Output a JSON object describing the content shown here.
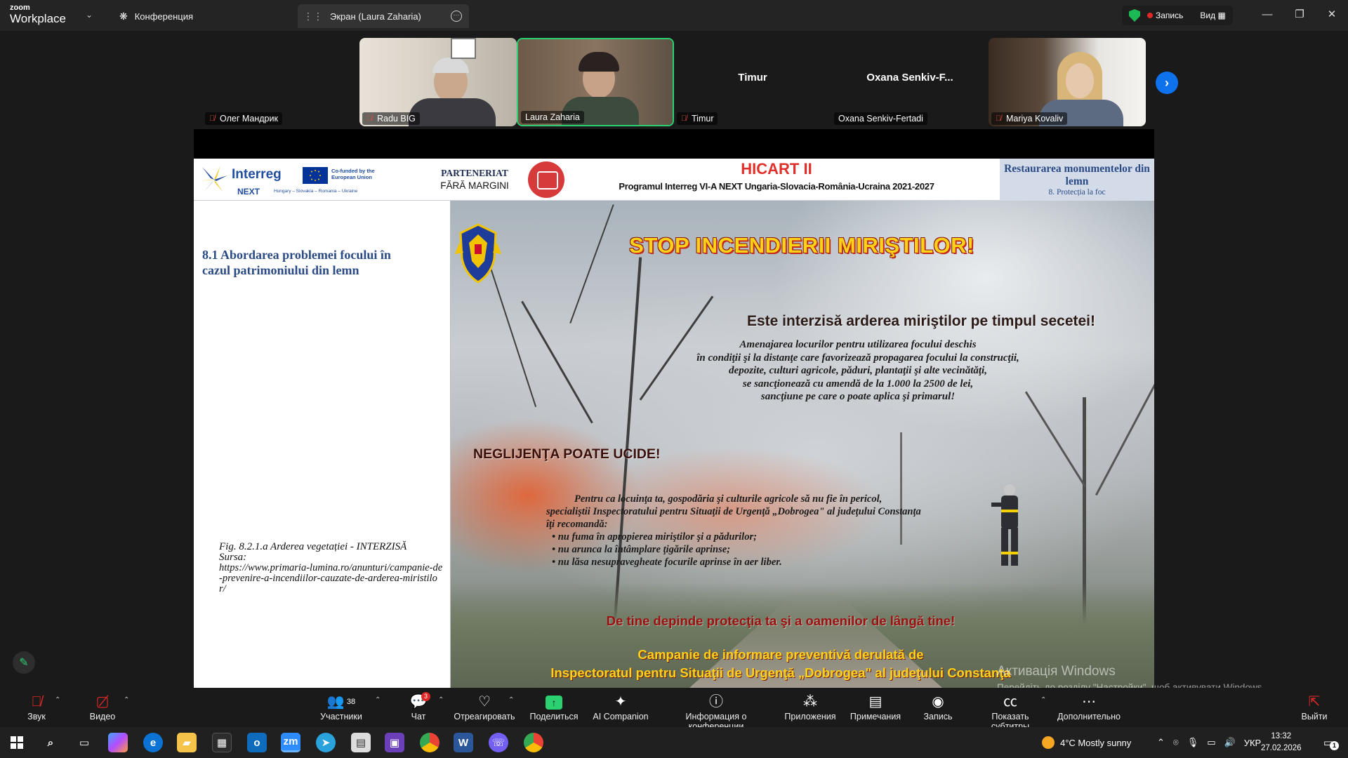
{
  "app": {
    "logo_small": "zoom",
    "logo_big": "Workplace",
    "tabs": [
      {
        "label": "Конференция"
      },
      {
        "label": "Экран (Laura Zaharia)"
      }
    ],
    "record_label": "Запись",
    "view_label": "Вид"
  },
  "participants": [
    {
      "name": "Олег Мандрик",
      "muted": true
    },
    {
      "name": "Radu BIG",
      "muted": true
    },
    {
      "name": "Laura Zaharia",
      "muted": false
    },
    {
      "name": "Timur",
      "muted": true,
      "center_name": "Timur"
    },
    {
      "name": "Oxana Senkiv-Fertadi",
      "muted": false,
      "center_name": "Oxana  Senkiv-F..."
    },
    {
      "name": "Mariya Kovaliv",
      "muted": true
    }
  ],
  "slide": {
    "logo_interreg": "Interreg",
    "logo_next": "NEXT",
    "logo_countries": "Hungary – Slovakia – Romania – Ukraine",
    "eu_cofunded": "Co-funded by the European Union",
    "partener_l1": "PARTENERIAT",
    "partener_l2": "FĂRĂ MARGINI",
    "hicart_title": "HICART II",
    "hicart_subtitle": "Programul Interreg VI-A NEXT Ungaria-Slovacia-România-Ucraina 2021-2027",
    "restaur_l1": "Restaurarea monumentelor din lemn",
    "restaur_l2": "8. Protecția la foc",
    "section_title": "8.1 Abordarea problemei focului în cazul patrimoniului din lemn",
    "caption_fig": "Fig. 8.2.1.a Arderea vegetației - INTERZISĂ",
    "caption_source": "Sursa:",
    "caption_url": "https://www.primaria-lumina.ro/anunturi/campanie-de-prevenire-a-incendiilor-cauzate-de-arderea-miristilor/",
    "poster": {
      "stop": "STOP INCENDIERII MIRIŞTILOR!",
      "interzisa": "Este interzisă arderea miriştilor pe timpul secetei!",
      "amen_lines": [
        "Amenajarea locurilor pentru utilizarea focului deschis",
        "în condiţii şi la distanţe care favorizează propagarea focului la construcţii,",
        "depozite, culturi agricole, păduri, plantaţii şi alte vecinătăţi,",
        "se sancţionează cu amendă de la 1.000 la 2500 de lei,",
        "sancţiune pe care o poate aplica şi primarul!"
      ],
      "negl": "NEGLIJENŢA POATE UCIDE!",
      "pentru_lines": [
        "Pentru ca locuinţa ta, gospodăria şi culturile agricole să nu fie în pericol,",
        "specialiştii Inspectoratului pentru Situaţii de Urgenţă „Dobrogea\" al judeţului Constanţa",
        "îţi recomandă:",
        "• nu fuma în apropierea miriştilor şi a pădurilor;",
        "• nu arunca la întâmplare ţigările aprinse;",
        "• nu lăsa nesupravegheate focurile aprinse în aer liber."
      ],
      "depinde": "De tine depinde protecţia ta şi a oamenilor de lângă tine!",
      "camp_l1": "Campanie de informare preventivă derulată de",
      "camp_l2": "Inspectoratul pentru Situaţii de Urgenţă „Dobrogea\" al judeţului Constanţa"
    }
  },
  "watermark": {
    "title": "Активація Windows",
    "subtitle": "Перейдіть до розділу \"Настройки\", щоб активувати Windows."
  },
  "toolbar": {
    "audio": "Звук",
    "video": "Видео",
    "participants": "Участники",
    "participants_count": "38",
    "chat": "Чат",
    "chat_badge": "3",
    "react": "Отреагировать",
    "share": "Поделиться",
    "ai": "AI Companion",
    "info": "Информация о конференции",
    "apps": "Приложения",
    "notes": "Примечания",
    "record": "Запись",
    "captions": "Показать субтитры",
    "more": "Дополнительно",
    "leave": "Выйти"
  },
  "taskbar": {
    "weather": "4°C  Mostly sunny",
    "lang": "УКР",
    "time": "13:32",
    "date": "27.02.2026",
    "notif": "1"
  },
  "colors": {
    "zoom_blue": "#0e72ed",
    "active_green": "#2bd070",
    "record_red": "#e02828"
  }
}
